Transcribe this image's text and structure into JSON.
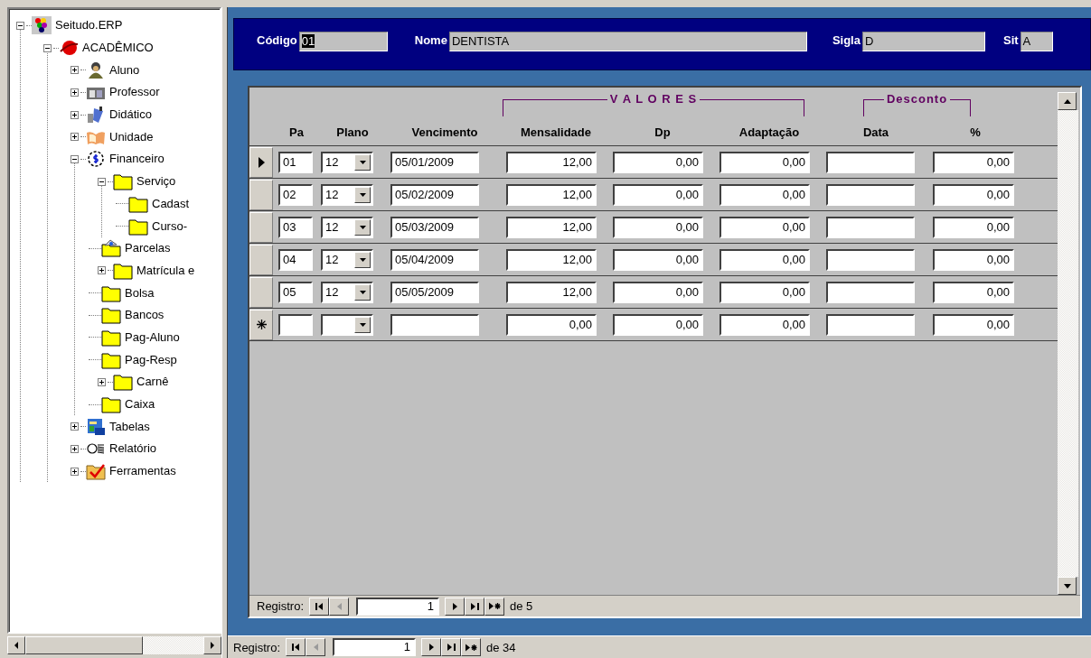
{
  "tree": {
    "items": [
      {
        "label": "Seitudo.ERP",
        "kind": "logo",
        "expanded": true,
        "children": [
          {
            "label": "ACADÊMICO",
            "kind": "globe",
            "expanded": true,
            "children": [
              {
                "label": "Aluno",
                "kind": "person",
                "expanded": false
              },
              {
                "label": "Professor",
                "kind": "projector",
                "expanded": false
              },
              {
                "label": "Didático",
                "kind": "books",
                "expanded": false
              },
              {
                "label": "Unidade",
                "kind": "openbook",
                "expanded": false
              },
              {
                "label": "Financeiro",
                "kind": "dollar",
                "expanded": true,
                "children": [
                  {
                    "label": "Serviço",
                    "kind": "folder",
                    "expanded": true,
                    "children": [
                      {
                        "label": "Cadast",
                        "kind": "folder"
                      },
                      {
                        "label": "Curso-",
                        "kind": "folder"
                      }
                    ]
                  },
                  {
                    "label": "Parcelas",
                    "kind": "folder-open"
                  },
                  {
                    "label": "Matrícula e",
                    "kind": "folder",
                    "expanded": false
                  },
                  {
                    "label": "Bolsa",
                    "kind": "folder"
                  },
                  {
                    "label": "Bancos",
                    "kind": "folder"
                  },
                  {
                    "label": "Pag-Aluno",
                    "kind": "folder"
                  },
                  {
                    "label": "Pag-Resp",
                    "kind": "folder"
                  },
                  {
                    "label": "Carnê",
                    "kind": "folder",
                    "expanded": false
                  },
                  {
                    "label": "Caixa",
                    "kind": "folder"
                  }
                ]
              },
              {
                "label": "Tabelas",
                "kind": "tables",
                "expanded": false
              },
              {
                "label": "Relatório",
                "kind": "glasses",
                "expanded": false
              },
              {
                "label": "Ferramentas",
                "kind": "checkfolder",
                "expanded": false
              }
            ]
          }
        ]
      }
    ]
  },
  "header": {
    "fields": [
      {
        "label": "Código",
        "value": "01",
        "highlighted": true,
        "kind": "short"
      },
      {
        "label": "Nome",
        "value": "DENTISTA",
        "highlighted": false,
        "kind": "wide"
      },
      {
        "label": "Sigla",
        "value": "D",
        "highlighted": false,
        "kind": "medium"
      },
      {
        "label": "Sit",
        "value": "A",
        "highlighted": false,
        "kind": "tiny"
      }
    ]
  },
  "subform": {
    "columns": [
      {
        "label": "Pa",
        "kind": "text"
      },
      {
        "label": "Plano",
        "kind": "combo"
      },
      {
        "label": "Vencimento",
        "kind": "text"
      },
      {
        "group": "V A L O R E S",
        "columns": [
          {
            "label": "Mensalidade",
            "kind": "number"
          },
          {
            "label": "Dp",
            "kind": "number"
          },
          {
            "label": "Adaptação",
            "kind": "number"
          }
        ]
      },
      {
        "group": "Desconto",
        "columns": [
          {
            "label": "Data",
            "kind": "text"
          },
          {
            "label": "%",
            "kind": "number"
          }
        ]
      }
    ],
    "rows": [
      {
        "current": true,
        "new": false,
        "cells": [
          "01",
          "12",
          "05/01/2009",
          "12,00",
          "0,00",
          "0,00",
          "",
          "0,00"
        ]
      },
      {
        "current": false,
        "new": false,
        "cells": [
          "02",
          "12",
          "05/02/2009",
          "12,00",
          "0,00",
          "0,00",
          "",
          "0,00"
        ]
      },
      {
        "current": false,
        "new": false,
        "cells": [
          "03",
          "12",
          "05/03/2009",
          "12,00",
          "0,00",
          "0,00",
          "",
          "0,00"
        ]
      },
      {
        "current": false,
        "new": false,
        "cells": [
          "04",
          "12",
          "05/04/2009",
          "12,00",
          "0,00",
          "0,00",
          "",
          "0,00"
        ]
      },
      {
        "current": false,
        "new": false,
        "cells": [
          "05",
          "12",
          "05/05/2009",
          "12,00",
          "0,00",
          "0,00",
          "",
          "0,00"
        ]
      },
      {
        "current": false,
        "new": true,
        "cells": [
          "",
          "",
          "",
          "0,00",
          "0,00",
          "0,00",
          "",
          "0,00"
        ]
      }
    ],
    "navigator": {
      "label": "Registro:",
      "current": "1",
      "total": "de 5",
      "buttons": [
        {
          "kind": "first",
          "disabled": false
        },
        {
          "kind": "prev",
          "disabled": true
        },
        {
          "kind": "next",
          "disabled": false
        },
        {
          "kind": "last",
          "disabled": false
        },
        {
          "kind": "new",
          "disabled": false
        }
      ]
    }
  },
  "navigator": {
    "label": "Registro:",
    "current": "1",
    "total": "de 34",
    "buttons": [
      {
        "kind": "first",
        "disabled": false
      },
      {
        "kind": "prev",
        "disabled": true
      },
      {
        "kind": "next",
        "disabled": false
      },
      {
        "kind": "last",
        "disabled": false
      },
      {
        "kind": "new",
        "disabled": false
      }
    ]
  }
}
